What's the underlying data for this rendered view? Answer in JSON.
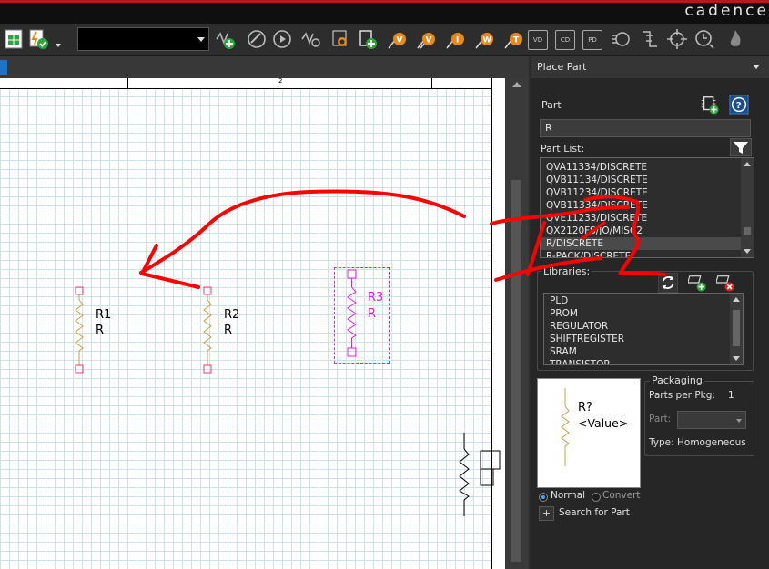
{
  "brand": {
    "name": "cadence"
  },
  "toolbar": {
    "combo_value": "",
    "icons": [
      "grid-sheet-icon",
      "lightning-check-icon",
      "add-part-icon",
      "probe-icon",
      "play-icon",
      "find-net-icon",
      "find-part-icon",
      "place-part-icon",
      "voltage-marker-icon",
      "voltage-diff-icon",
      "current-marker-icon",
      "power-marker-icon",
      "title-marker-icon",
      "vd-icon",
      "cd-icon",
      "pd-icon",
      "run-icon",
      "netlist-icon",
      "target-icon",
      "clock-icon",
      "flame-icon"
    ],
    "badges": {
      "vd": "VD",
      "cd": "CD",
      "pd": "PD"
    }
  },
  "canvas": {
    "ruler_number": "2",
    "parts": [
      {
        "ref": "R1",
        "value": "R"
      },
      {
        "ref": "R2",
        "value": "R"
      },
      {
        "ref": "R3",
        "value": "R"
      }
    ]
  },
  "panel": {
    "title": "Place Part",
    "part_label": "Part",
    "part_value": "R",
    "part_list_label": "Part List:",
    "part_list": [
      "QVA11334/DISCRETE",
      "QVB11134/DISCRETE",
      "QVB11234/DISCRETE",
      "QVB11334/DISCRETE",
      "QVE11233/DISCRETE",
      "QX2120FS/JO/MISC2",
      "R/DISCRETE",
      "R-PACK/DISCRETE"
    ],
    "part_list_selected": 6,
    "libraries_label": "Libraries:",
    "libraries": [
      "PLD",
      "PROM",
      "REGULATOR",
      "SHIFTREGISTER",
      "SRAM",
      "TRANSISTOR"
    ],
    "preview": {
      "ref": "R?",
      "value": "<Value>"
    },
    "packaging": {
      "title": "Packaging",
      "parts_per_pkg_label": "Parts per Pkg:",
      "parts_per_pkg": "1",
      "part_label": "Part:",
      "type_label": "Type:",
      "type_value": "Homogeneous"
    },
    "radio_normal": "Normal",
    "radio_convert": "Convert",
    "search_plus": "+",
    "search_label": "Search for Part"
  },
  "colors": {
    "accent": "#b8171d",
    "selected_part": "#e020e0",
    "resistor": "#c8a045",
    "pin": "#e0407a",
    "annotation": "#ff0000"
  }
}
